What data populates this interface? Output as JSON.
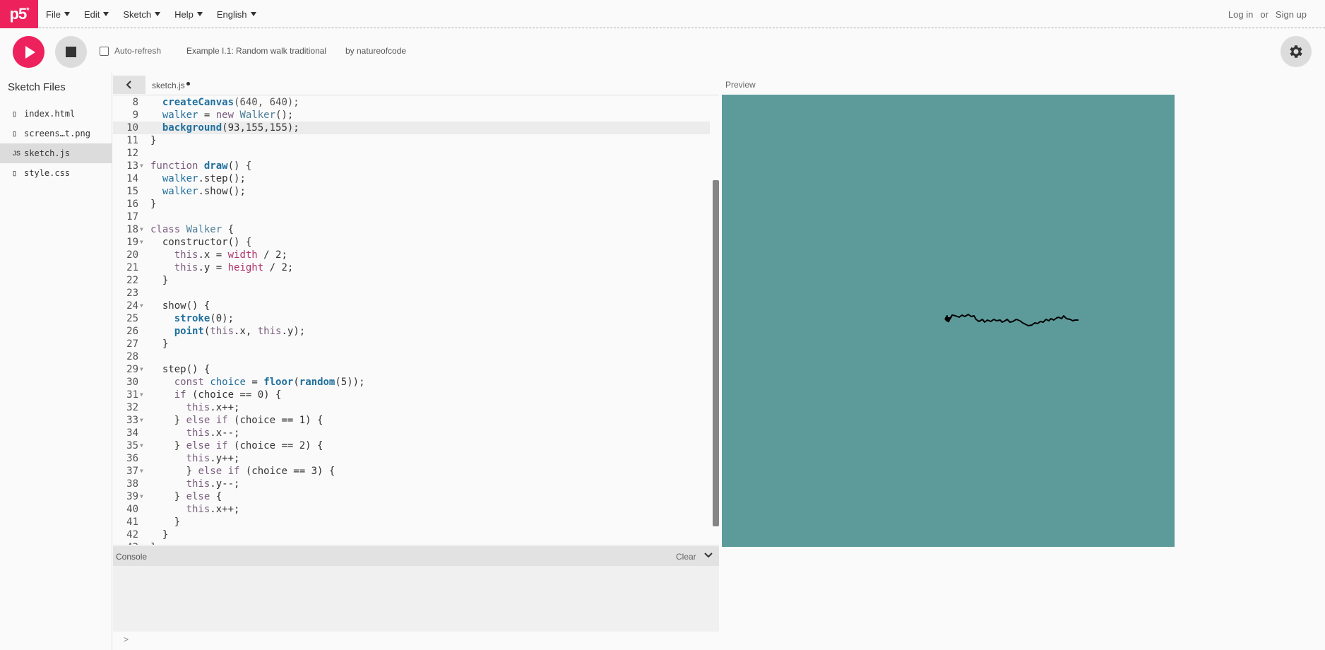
{
  "nav": {
    "logo": "p5",
    "logo_mark": "*",
    "menus": [
      {
        "label": "File"
      },
      {
        "label": "Edit"
      },
      {
        "label": "Sketch"
      },
      {
        "label": "Help"
      },
      {
        "label": "English"
      }
    ],
    "login": "Log in",
    "or": "or",
    "signup": "Sign up"
  },
  "toolbar": {
    "auto_refresh_label": "Auto-refresh",
    "auto_refresh_checked": false,
    "sketch_title": "Example I.1: Random walk traditional",
    "author": "by natureofcode"
  },
  "sidebar": {
    "title": "Sketch Files",
    "files": [
      {
        "name": "index.html",
        "icon": "file-icon",
        "active": false
      },
      {
        "name": "screens…t.png",
        "icon": "file-icon",
        "active": false
      },
      {
        "name": "sketch.js",
        "icon": "js-icon",
        "active": true
      },
      {
        "name": "style.css",
        "icon": "file-icon",
        "active": false
      }
    ]
  },
  "editor": {
    "tab_name": "sketch.js",
    "unsaved": true
  },
  "console": {
    "title": "Console",
    "clear_label": "Clear",
    "prompt": ">"
  },
  "preview": {
    "label": "Preview",
    "background_color": "#5d9b9b",
    "stroke_color": "#000000"
  },
  "colors": {
    "accent": "#ed225d",
    "button_grey": "#dcdcdc"
  }
}
